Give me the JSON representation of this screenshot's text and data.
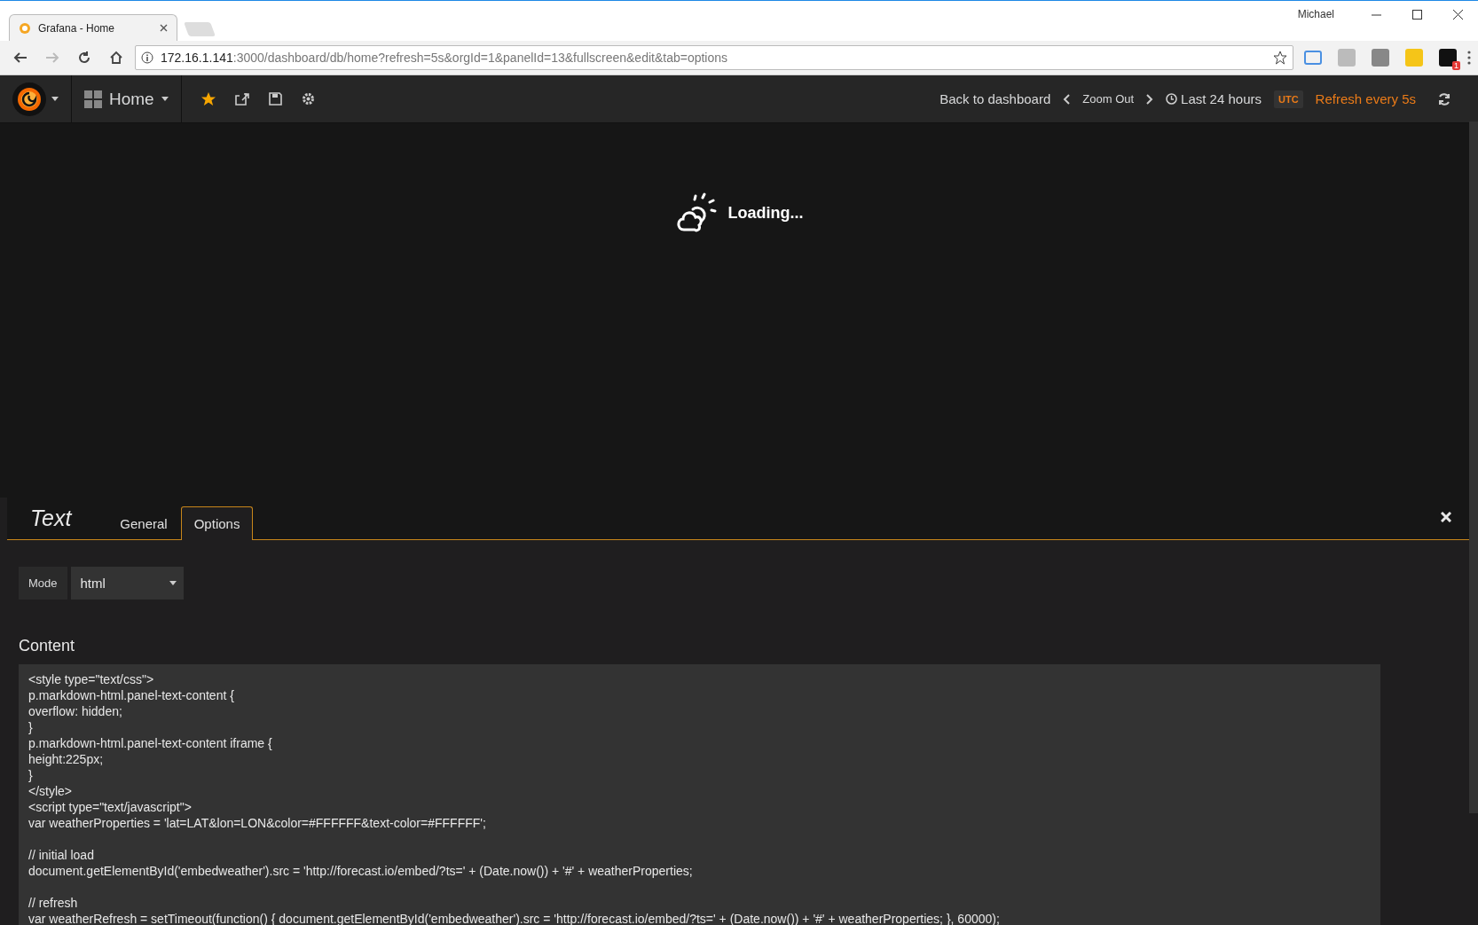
{
  "browser": {
    "tab_title": "Grafana - Home",
    "profile": "Michael",
    "url_host": "172.16.1.141",
    "url_rest": ":3000/dashboard/db/home?refresh=5s&orgId=1&panelId=13&fullscreen&edit&tab=options",
    "extension_badge": "1"
  },
  "navbar": {
    "dashboard": "Home",
    "back": "Back to dashboard",
    "zoom_out": "Zoom Out",
    "time_range": "Last 24 hours",
    "timezone": "UTC",
    "refresh": "Refresh every 5s"
  },
  "panel": {
    "loading": "Loading..."
  },
  "editor": {
    "title": "Text",
    "tabs": [
      {
        "label": "General",
        "selected": false
      },
      {
        "label": "Options",
        "selected": true
      }
    ],
    "mode_label": "Mode",
    "mode_value": "html",
    "content_label": "Content",
    "code_blocks": [
      [
        "<style type=\"text/css\">",
        "p.markdown-html.panel-text-content {",
        "overflow: hidden;",
        "}",
        "p.markdown-html.panel-text-content iframe {",
        "height:225px;",
        "}",
        "</style>",
        "<script type=\"text/javascript\">",
        "var weatherProperties = 'lat=LAT&lon=LON&color=#FFFFFF&text-color=#FFFFFF';"
      ],
      [
        "// initial load",
        "document.getElementById('embedweather').src = 'http://forecast.io/embed/?ts=' + (Date.now()) + '#' + weatherProperties;"
      ],
      [
        "// refresh",
        "var weatherRefresh = setTimeout(function() { document.getElementById('embedweather').src = 'http://forecast.io/embed/?ts=' + (Date.now()) + '#' + weatherProperties; }, 60000);"
      ]
    ]
  }
}
